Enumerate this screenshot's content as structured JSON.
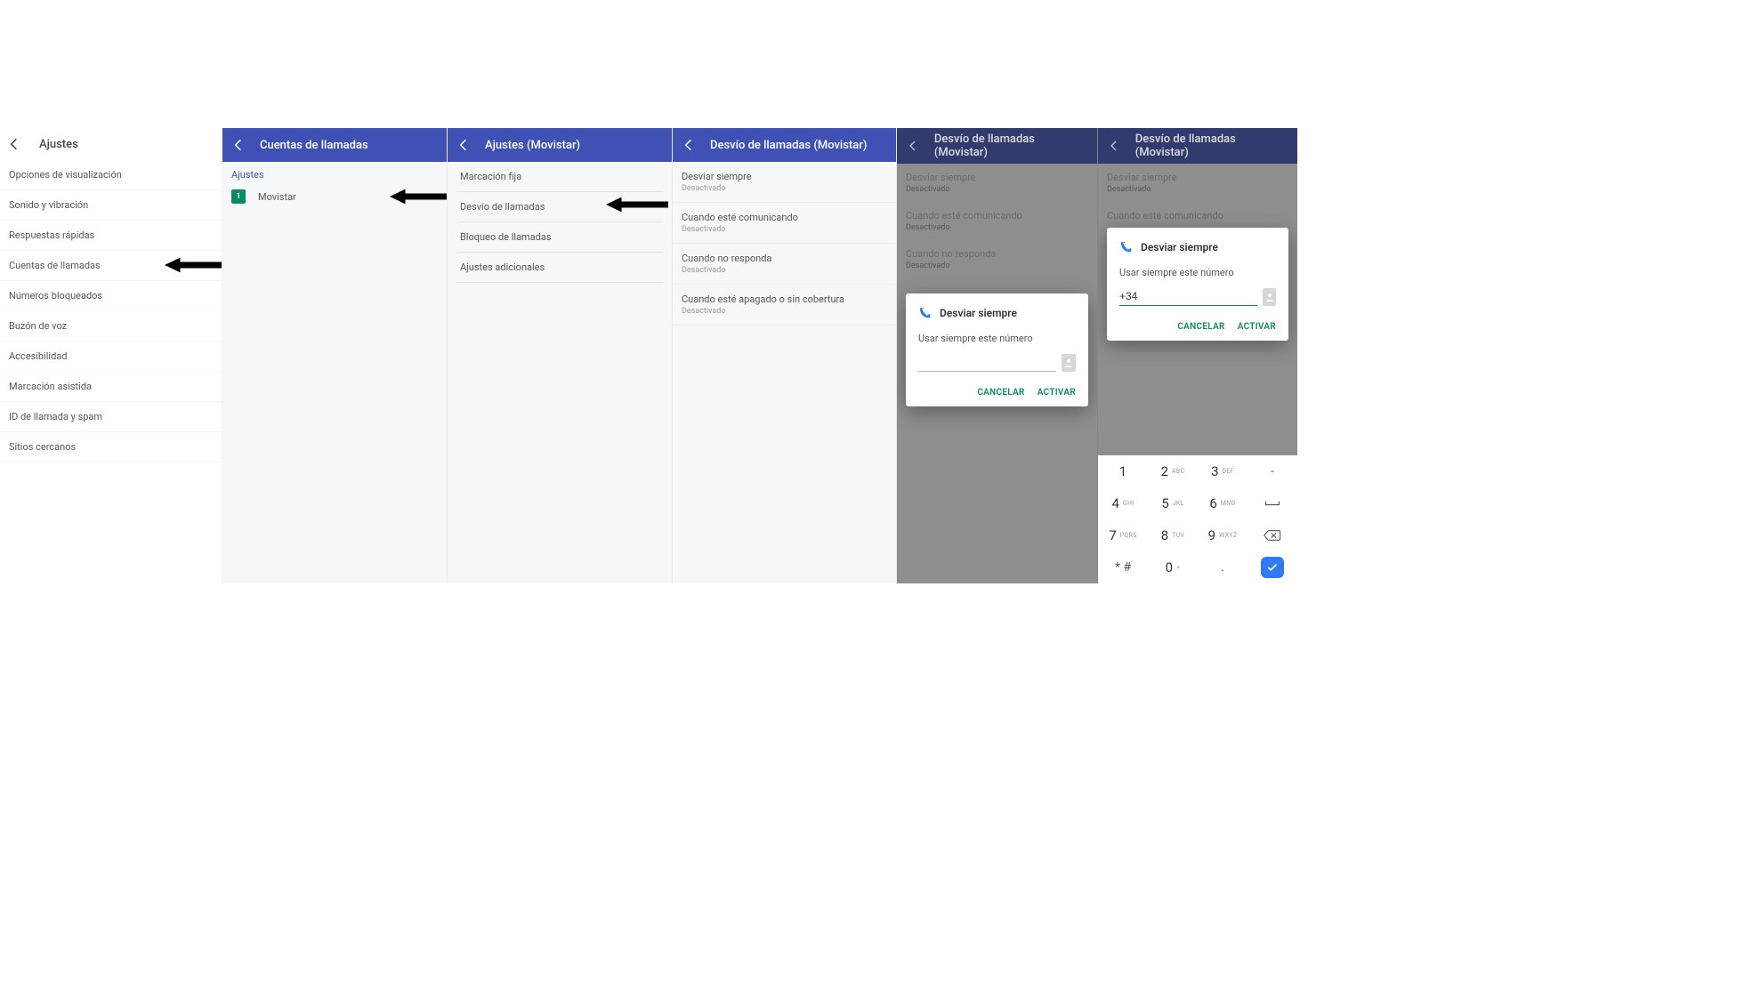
{
  "colors": {
    "brand_blue": "#3f51b5",
    "accent_green": "#0a8a5f",
    "key_enter": "#2f7bf5"
  },
  "panel1": {
    "title": "Ajustes",
    "items": [
      "Opciones de visualización",
      "Sonido y vibración",
      "Respuestas rápidas",
      "Cuentas de llamadas",
      "Números bloqueados",
      "Buzón de voz",
      "Accesibilidad",
      "Marcación asistida",
      "ID de llamada y spam",
      "Sitios cercanos"
    ],
    "arrow_index": 3
  },
  "panel2": {
    "title": "Cuentas de llamadas",
    "section": "Ajustes",
    "sim_badge": "1",
    "sim_name": "Movistar"
  },
  "panel3": {
    "title": "Ajustes (Movistar)",
    "items": [
      "Marcación fija",
      "Desvío de llamadas",
      "Bloqueo de llamadas",
      "Ajustes adicionales"
    ],
    "arrow_index": 1
  },
  "panel4": {
    "title": "Desvío de llamadas (Movistar)",
    "items": [
      {
        "label": "Desviar siempre",
        "sub": "Desactivado"
      },
      {
        "label": "Cuando esté comunicando",
        "sub": "Desactivado"
      },
      {
        "label": "Cuando no responda",
        "sub": "Desactivado"
      },
      {
        "label": "Cuando esté apagado o sin cobertura",
        "sub": "Desactivado"
      }
    ]
  },
  "panel5": {
    "title": "Desvío de llamadas (Movistar)",
    "items": [
      {
        "label": "Desviar siempre",
        "sub": "Desactivado"
      },
      {
        "label": "Cuando esté comunicando",
        "sub": "Desactivado"
      },
      {
        "label": "Cuando no responda",
        "sub": "Desactivado"
      }
    ],
    "dialog": {
      "title": "Desviar siempre",
      "label": "Usar siempre este número",
      "value": "",
      "cancel": "CANCELAR",
      "confirm": "ACTIVAR"
    }
  },
  "panel6": {
    "title": "Desvío de llamadas (Movistar)",
    "items": [
      {
        "label": "Desviar siempre",
        "sub": "Desactivado"
      },
      {
        "label": "Cuando esté comunicando",
        "sub": ""
      }
    ],
    "dialog": {
      "title": "Desviar siempre",
      "label": "Usar siempre este número",
      "value": "+34",
      "cancel": "CANCELAR",
      "confirm": "ACTIVAR"
    },
    "keypad": [
      {
        "d": "1",
        "l": ""
      },
      {
        "d": "2",
        "l": "ABC"
      },
      {
        "d": "3",
        "l": "DEF"
      },
      {
        "d": "-",
        "l": ""
      },
      {
        "d": "4",
        "l": "GHI"
      },
      {
        "d": "5",
        "l": "JKL"
      },
      {
        "d": "6",
        "l": "MNO"
      },
      {
        "d": "␣",
        "l": ""
      },
      {
        "d": "7",
        "l": "PQRS"
      },
      {
        "d": "8",
        "l": "TUV"
      },
      {
        "d": "9",
        "l": "WXYZ"
      },
      {
        "d": "⌫",
        "l": ""
      },
      {
        "d": "* #",
        "l": ""
      },
      {
        "d": "0",
        "l": "+"
      },
      {
        "d": ".",
        "l": ""
      },
      {
        "d": "✓",
        "l": ""
      }
    ]
  }
}
